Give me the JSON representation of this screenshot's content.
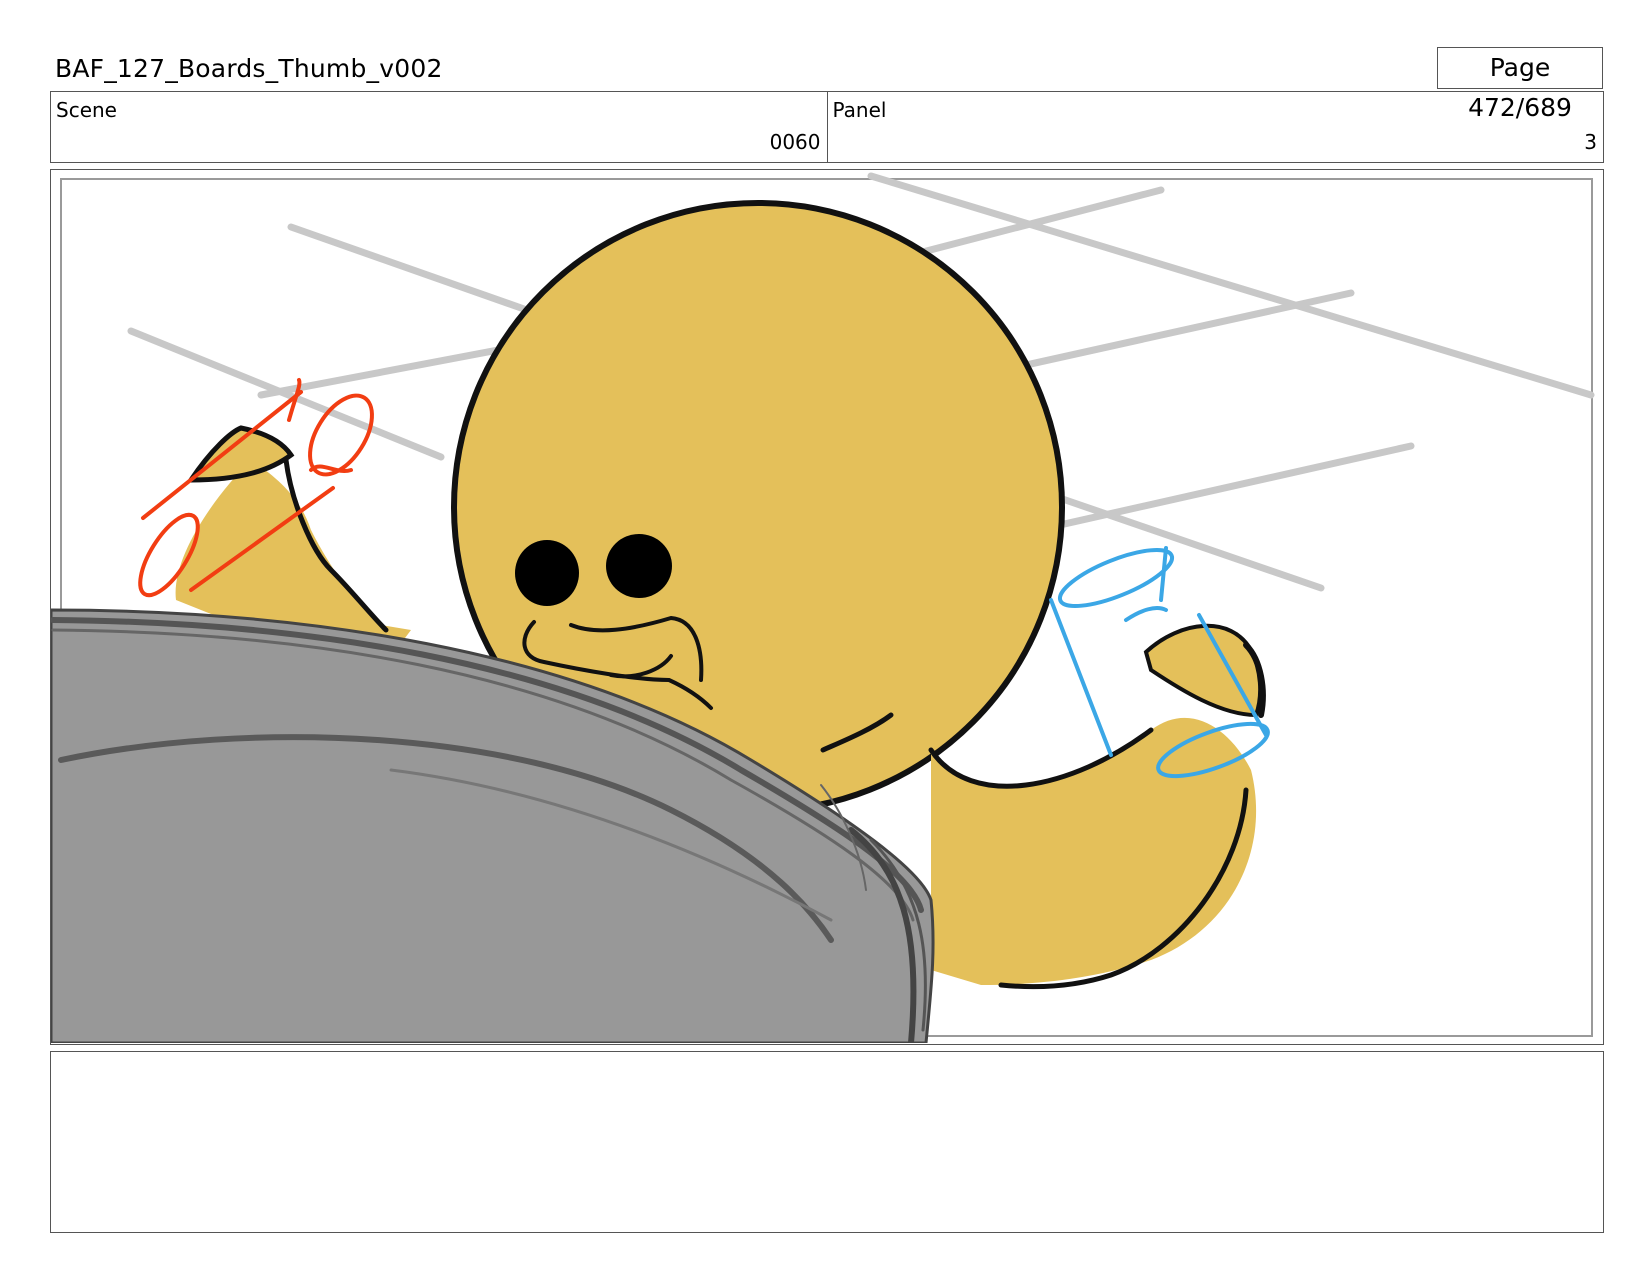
{
  "header": {
    "document_title": "BAF_127_Boards_Thumb_v002",
    "page_label": "Page 472/689"
  },
  "info": {
    "scene_label": "Scene",
    "scene_value": "0060",
    "panel_label": "Panel",
    "panel_value": "3"
  },
  "artwork": {
    "colors": {
      "character": "#E4C05A",
      "table": "#989898",
      "red_cup": "#F23D12",
      "blue_cup": "#3BA7E6",
      "ceiling_lines": "#C8C8C8"
    }
  },
  "notes": {
    "text": ""
  }
}
